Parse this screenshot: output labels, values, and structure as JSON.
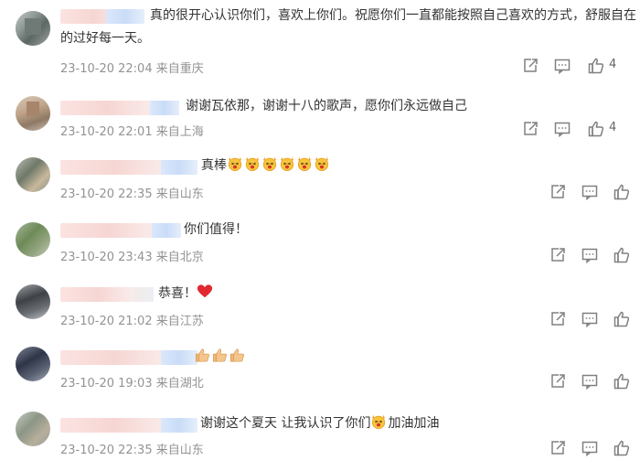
{
  "comments": [
    {
      "text": "真的很开心认识你们，喜欢上你们。祝愿你们一直都能按照自己喜欢的方式，舒服自在的过好每一天。",
      "date": "23-10-20 22:04",
      "location": "来自重庆",
      "likes": "4"
    },
    {
      "text": "谢谢瓦依那，谢谢十八的歌声，愿你们永远做自己",
      "date": "23-10-20 22:01",
      "location": "来自上海",
      "likes": "4"
    },
    {
      "text": "真棒",
      "emoji_count": 6,
      "emoji_name": "cheering-face-emoji",
      "date": "23-10-20 22:35",
      "location": "来自山东",
      "likes": ""
    },
    {
      "text": "你们值得！",
      "date": "23-10-20 23:43",
      "location": "来自北京",
      "likes": ""
    },
    {
      "text": "恭喜！",
      "emoji_name": "red-heart-emoji",
      "date": "23-10-20 21:02",
      "location": "来自江苏",
      "likes": ""
    },
    {
      "text": "",
      "emoji_count": 3,
      "emoji_name": "thumbs-up-emoji",
      "date": "23-10-20 19:03",
      "location": "来自湖北",
      "likes": ""
    },
    {
      "text_before": "谢谢这个夏天 让我认识了你们",
      "text_after": "加油加油",
      "emoji_name": "cheering-face-emoji",
      "date": "23-10-20 22:35",
      "location": "来自山东",
      "likes": ""
    }
  ],
  "icons": {
    "share": "share-icon",
    "comment": "comment-icon",
    "like": "thumbs-up-icon"
  },
  "colors": {
    "text": "#333333",
    "meta": "#939393",
    "icon": "#808080"
  }
}
